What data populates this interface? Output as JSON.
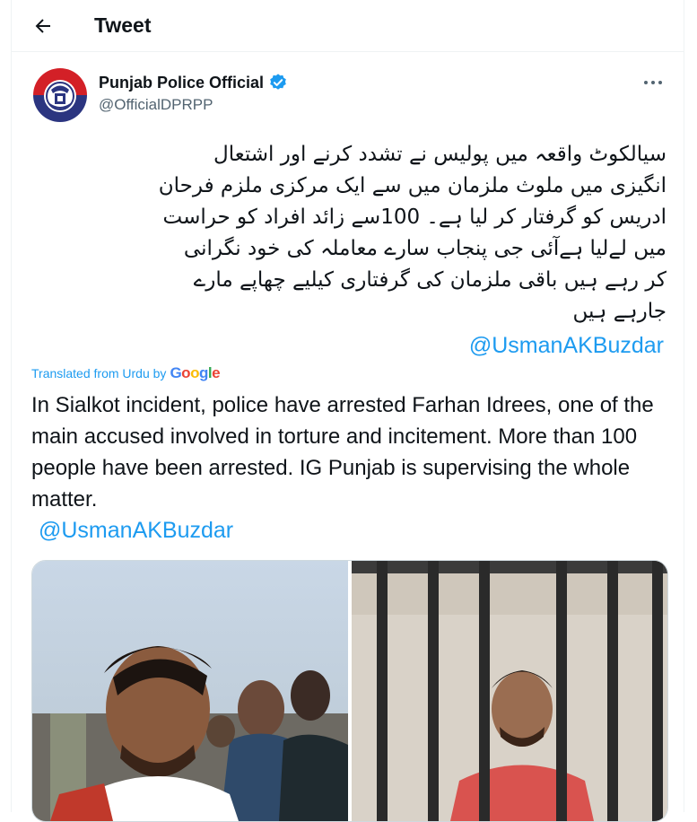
{
  "header": {
    "title": "Tweet"
  },
  "tweet": {
    "author_name": "Punjab Police Official",
    "handle": "@OfficialDPRPP",
    "urdu_lines": [
      "سیالکوٹ واقعہ میں پولیس نے تشدد کرنے اور اشتعال",
      "انگیزی میں ملوث ملزمان میں سے ایک مرکزی ملزم فرحان",
      "ادریس کو گرفتار کر لیا ہے۔ 100سے زائد افراد کو حراست",
      "میں لےلیا ہےآئی جی پنجاب سارے معاملہ کی خود نگرانی",
      "کر رہے ہیں باقی ملزمان کی گرفتاری کیلیے چھاپے مارے",
      "جارہے ہیں"
    ],
    "urdu_mention": "@UsmanAKBuzdar",
    "translated_label": "Translated from Urdu by",
    "google_letters": [
      "G",
      "o",
      "o",
      "g",
      "l",
      "e"
    ],
    "google_colors": [
      "#4285f4",
      "#ea4335",
      "#fbbc05",
      "#4285f4",
      "#34a853",
      "#ea4335"
    ],
    "english_text": "In Sialkot incident, police have arrested Farhan Idrees, one of the main accused involved in torture and incitement. More than 100 people have been arrested. IG Punjab is supervising the whole matter.",
    "english_mention": "@UsmanAKBuzdar"
  },
  "icons": {
    "back": "back-arrow-icon",
    "verified": "verified-badge-icon",
    "more": "more-options-icon",
    "avatar": "punjab-police-logo"
  },
  "colors": {
    "accent": "#1d9bf0",
    "secondary_text": "#536471",
    "avatar_red": "#d32027",
    "avatar_navy": "#2b3580"
  }
}
